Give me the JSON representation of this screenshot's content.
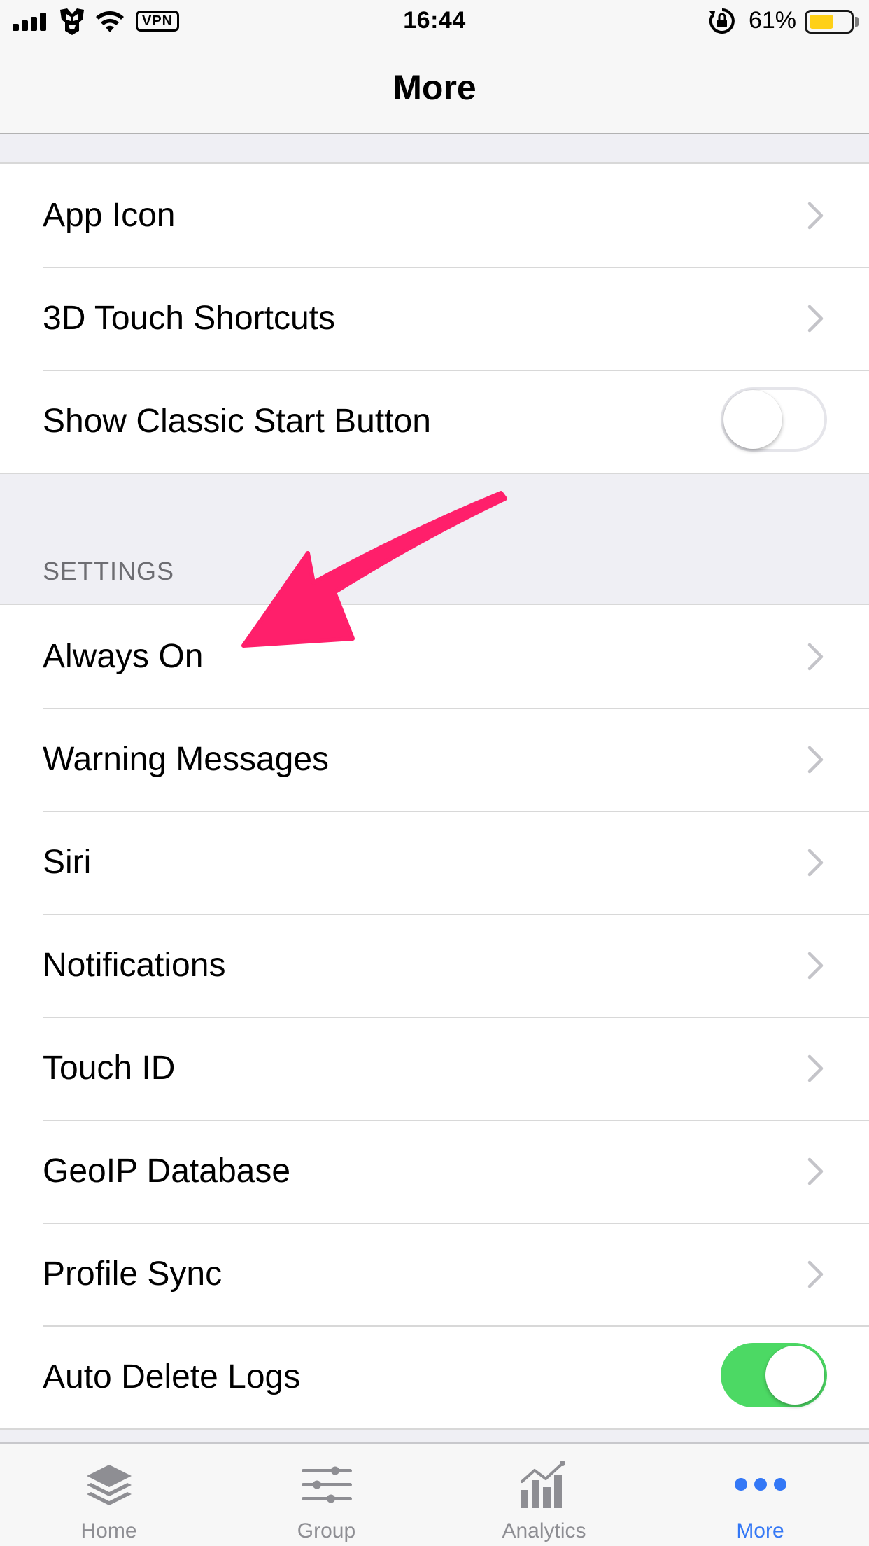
{
  "status_bar": {
    "time": "16:44",
    "vpn_label": "VPN",
    "battery_percent": "61%",
    "battery_level": 0.61,
    "battery_color": "#ffcc00"
  },
  "nav": {
    "title": "More"
  },
  "top_group": {
    "rows": [
      {
        "label": "App Icon",
        "accessory": "chevron"
      },
      {
        "label": "3D Touch Shortcuts",
        "accessory": "chevron"
      },
      {
        "label": "Show Classic Start Button",
        "accessory": "toggle",
        "value": false
      }
    ]
  },
  "settings": {
    "header": "SETTINGS",
    "rows": [
      {
        "label": "Always On",
        "accessory": "chevron"
      },
      {
        "label": "Warning Messages",
        "accessory": "chevron"
      },
      {
        "label": "Siri",
        "accessory": "chevron"
      },
      {
        "label": "Notifications",
        "accessory": "chevron"
      },
      {
        "label": "Touch ID",
        "accessory": "chevron"
      },
      {
        "label": "GeoIP Database",
        "accessory": "chevron"
      },
      {
        "label": "Profile Sync",
        "accessory": "chevron"
      },
      {
        "label": "Auto Delete Logs",
        "accessory": "toggle",
        "value": true
      }
    ]
  },
  "tab_bar": {
    "tabs": [
      {
        "label": "Home",
        "icon": "layers-icon",
        "active": false
      },
      {
        "label": "Group",
        "icon": "sliders-icon",
        "active": false
      },
      {
        "label": "Analytics",
        "icon": "bar-chart-icon",
        "active": false
      },
      {
        "label": "More",
        "icon": "more-dots-icon",
        "active": true
      }
    ],
    "active_color": "#3478f6",
    "inactive_color": "#8e8e93"
  },
  "colors": {
    "toggle_on": "#4cd964",
    "annotation_arrow": "#ff1f6b"
  }
}
